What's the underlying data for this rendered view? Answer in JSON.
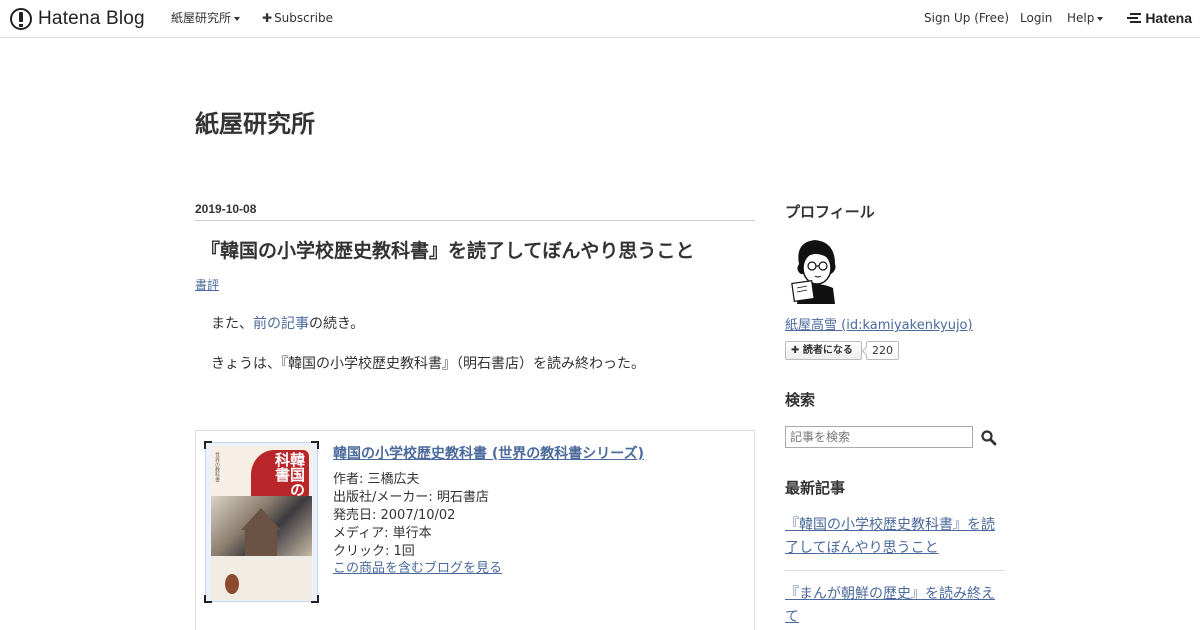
{
  "global_header": {
    "logo_text": "Hatena Blog",
    "blog_menu": "紙屋研究所",
    "subscribe": "Subscribe",
    "signup": "Sign Up (Free)",
    "login": "Login",
    "help": "Help",
    "hatena_logo": "Hatena"
  },
  "blog": {
    "title": "紙屋研究所"
  },
  "entry": {
    "date": "2019-10-08",
    "title": "『韓国の小学校歴史教科書』を読了してぼんやり思うこと",
    "category": "書評",
    "p1_prefix": "また、",
    "p1_link": "前の記事",
    "p1_suffix": "の続き。",
    "p2": "きょうは、『韓国の小学校歴史教科書』（明石書店）を読み終わった。"
  },
  "asin": {
    "title": "韓国の小学校歴史教科書 (世界の教科書シリーズ)",
    "author": "作者: 三橋広夫",
    "publisher": "出版社/メーカー: 明石書店",
    "release": "発売日: 2007/10/02",
    "media": "メディア: 単行本",
    "clicks": "クリック: 1回",
    "blogs_link": "この商品を含むブログを見る",
    "cover_text": "韓国の小学校歴史教科書",
    "cover_series": "世界の教科書"
  },
  "sidebar": {
    "profile_heading": "プロフィール",
    "profile_name": "紙屋高雪 (id:kamiyakenkyujo)",
    "subscribe_label": "読者になる",
    "subscriber_count": "220",
    "search_heading": "検索",
    "search_placeholder": "記事を検索",
    "recent_heading": "最新記事",
    "recent": [
      "『韓国の小学校歴史教科書』を読了してぼんやり思うこと",
      "『まんが朝鮮の歴史』を読み終えて"
    ]
  },
  "icons": {
    "hatena_logo": "hatena-logo-icon",
    "plus": "plus-icon",
    "caret": "caret-down-icon",
    "search": "magnifier-icon"
  },
  "colors": {
    "link": "#4c6a9c",
    "text": "#333333",
    "border": "#dddddd"
  }
}
